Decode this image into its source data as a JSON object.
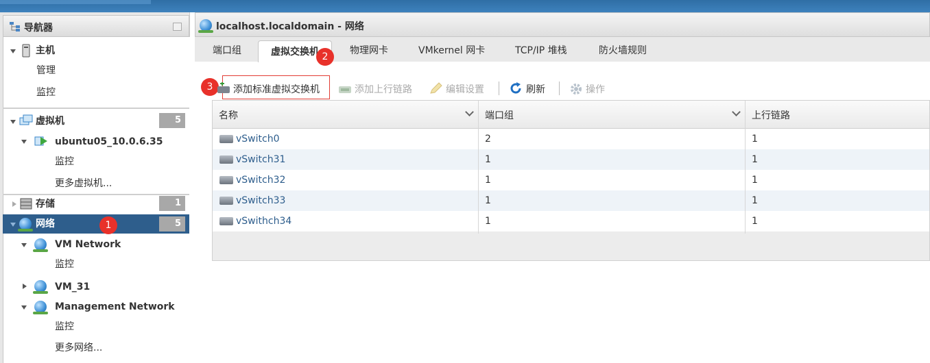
{
  "navigator": {
    "title": "导航器",
    "items": [
      {
        "label": "主机",
        "children": [
          "管理",
          "监控"
        ]
      },
      {
        "label": "虚拟机",
        "count": "5"
      },
      {
        "label": "ubuntu05_10.0.6.35"
      },
      {
        "label": "监控"
      },
      {
        "label": "更多虚拟机..."
      },
      {
        "label": "存储",
        "count": "1"
      },
      {
        "label": "网络",
        "count": "5"
      },
      {
        "label": "VM Network"
      },
      {
        "label": "监控"
      },
      {
        "label": "VM_31"
      },
      {
        "label": "Management Network"
      },
      {
        "label": "监控"
      },
      {
        "label": "更多网络..."
      }
    ]
  },
  "main": {
    "title": "localhost.localdomain - 网络",
    "tabs": [
      "端口组",
      "虚拟交换机",
      "物理网卡",
      "VMkernel 网卡",
      "TCP/IP 堆栈",
      "防火墙规则"
    ],
    "toolbar": {
      "add_std": "添加标准虚拟交换机",
      "add_uplink": "添加上行链路",
      "edit": "编辑设置",
      "refresh": "刷新",
      "actions": "操作"
    },
    "table": {
      "columns": [
        "名称",
        "端口组",
        "上行链路"
      ],
      "rows": [
        [
          "vSwitch0",
          "2",
          "1"
        ],
        [
          "vSwitch31",
          "1",
          "1"
        ],
        [
          "vSwitch32",
          "1",
          "1"
        ],
        [
          "vSwitch33",
          "1",
          "1"
        ],
        [
          "vSwithch34",
          "1",
          "1"
        ]
      ]
    }
  },
  "annotations": [
    "1",
    "2",
    "3"
  ],
  "colors": {
    "selected": "#2e5e8c",
    "annotation": "#e8312a",
    "link": "#2d5d8c"
  }
}
